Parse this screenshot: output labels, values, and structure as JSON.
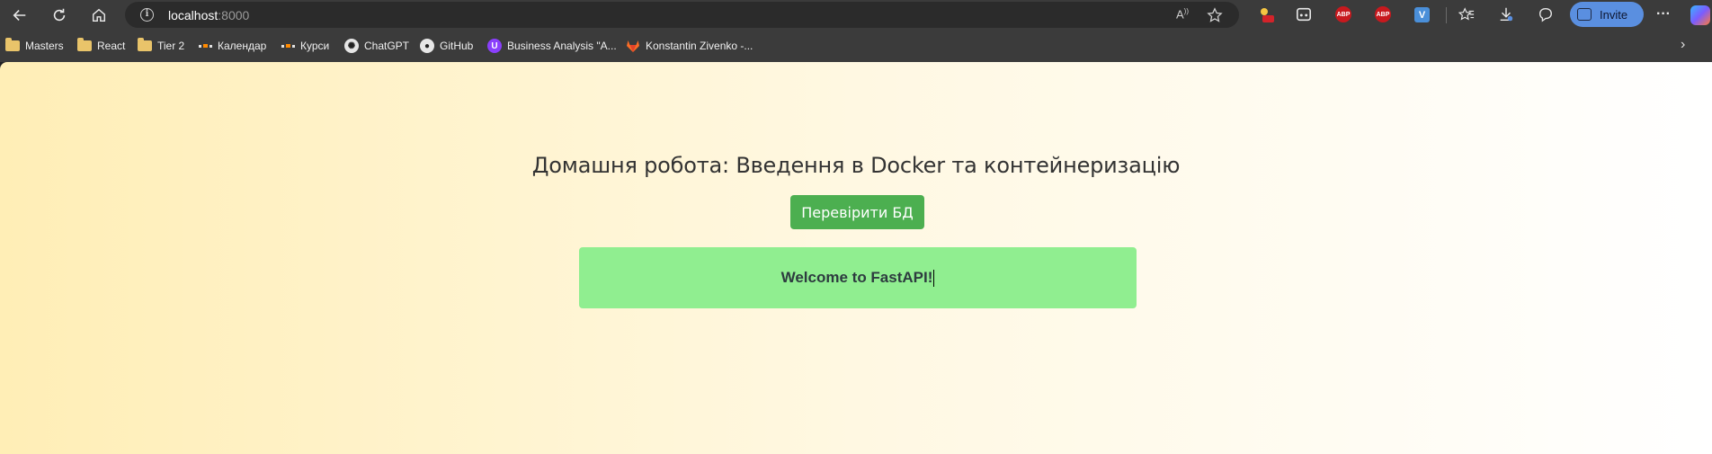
{
  "browser": {
    "address": {
      "host": "localhost",
      "port": ":8000"
    },
    "invite_label": "Invite",
    "icons": {
      "back": "back-arrow-icon",
      "reload": "reload-icon",
      "home": "home-icon",
      "info": "site-info-icon",
      "read_aloud": "read-aloud-icon",
      "favorite": "favorite-star-icon",
      "favorites": "favorites-icon",
      "downloads": "downloads-icon",
      "feedback": "feedback-icon",
      "more": "more-icon"
    },
    "extensions": {
      "abp_1": "ABP",
      "abp_2": "ABP",
      "v": "V"
    }
  },
  "bookmarks": [
    {
      "label": "Masters",
      "icon": "folder-icon"
    },
    {
      "label": "React",
      "icon": "folder-icon"
    },
    {
      "label": "Tier 2",
      "icon": "folder-icon"
    },
    {
      "label": "Календар",
      "icon": "calendar-site-icon"
    },
    {
      "label": "Курси",
      "icon": "courses-site-icon"
    },
    {
      "label": "ChatGPT",
      "icon": "chatgpt-icon"
    },
    {
      "label": "GitHub",
      "icon": "github-icon"
    },
    {
      "label": "Business Analysis \"A...",
      "icon": "udemy-icon"
    },
    {
      "label": "Konstantin Zivenko -...",
      "icon": "gitlab-icon"
    }
  ],
  "page": {
    "title": "Домашня робота: Введення в Docker та контейнеризацію",
    "check_button": "Перевірити БД",
    "message": "Welcome to FastAPI!",
    "colors": {
      "button": "#4caf50",
      "message_bg": "#90ee90"
    }
  }
}
